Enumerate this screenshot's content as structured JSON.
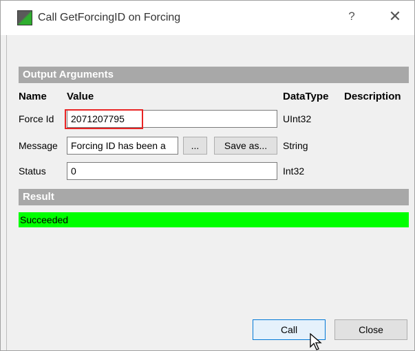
{
  "window": {
    "title": "Call GetForcingID on Forcing",
    "help_glyph": "?",
    "close_glyph": "✕"
  },
  "output": {
    "header": "Output Arguments",
    "columns": {
      "name": "Name",
      "value": "Value",
      "datatype": "DataType",
      "description": "Description"
    },
    "rows": [
      {
        "name": "Force Id",
        "value": "2071207795",
        "datatype": "UInt32"
      },
      {
        "name": "Message",
        "value": "Forcing ID has been a",
        "datatype": "String",
        "ellipsis_label": "...",
        "saveas_label": "Save as..."
      },
      {
        "name": "Status",
        "value": "0",
        "datatype": "Int32"
      }
    ]
  },
  "result": {
    "header": "Result",
    "status": "Succeeded",
    "status_color": "#00ff00"
  },
  "buttons": {
    "call": "Call",
    "close": "Close"
  },
  "colors": {
    "section_header": "#a8a8a8",
    "highlight": "#e82323",
    "call_border": "#0078d7"
  },
  "icons": [
    "app-icon",
    "help-icon",
    "close-icon",
    "mouse-cursor-icon"
  ]
}
